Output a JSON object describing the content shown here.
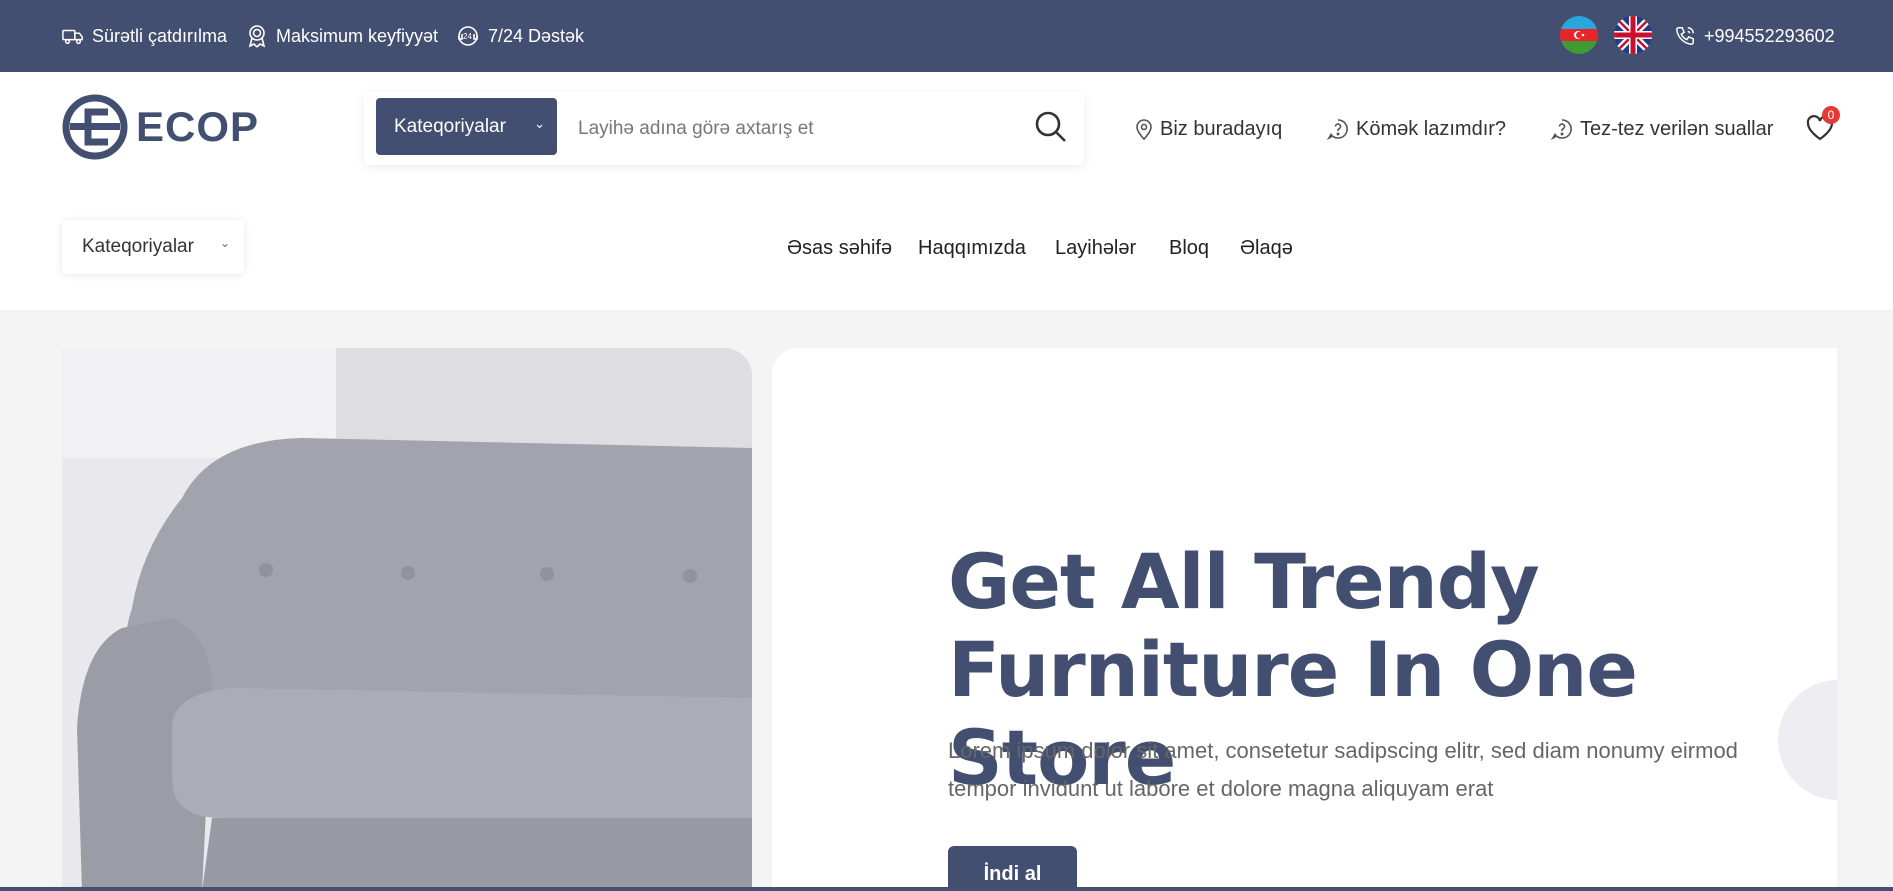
{
  "topbar": {
    "items": [
      {
        "label": "Sürətli çatdırılma",
        "icon": "truck-icon"
      },
      {
        "label": "Maksimum keyfiyyət",
        "icon": "award-badge-icon"
      },
      {
        "label": "7/24 Dəstək",
        "icon": "support-24-icon"
      }
    ],
    "phone": "+994552293602",
    "languages": [
      "Azerbaijani",
      "English"
    ]
  },
  "header": {
    "logo_text": "ECOP",
    "category_button": "Kateqoriyalar",
    "search_placeholder": "Layihə adına görə axtarış et",
    "links": {
      "location": "Biz buradayıq",
      "help": "Kömək lazımdır?",
      "faq": "Tez-tez verilən suallar"
    },
    "wishlist_count": "0"
  },
  "navbar": {
    "category_select": "Kateqoriyalar",
    "items": [
      "Əsas səhifə",
      "Haqqımızda",
      "Layihələr",
      "Bloq",
      "Əlaqə"
    ]
  },
  "hero": {
    "title_line1": "Get All Trendy",
    "title_line2": "Furniture In One Store",
    "text": "Lorem ipsum dolor sit amet, consetetur sadipscing elitr, sed diam nonumy eirmod tempor invidunt ut labore et dolore magna aliquyam erat",
    "button": "İndi al"
  },
  "colors": {
    "primary": "#434f70",
    "badge": "#e53935",
    "background": "#f4f4f4"
  }
}
